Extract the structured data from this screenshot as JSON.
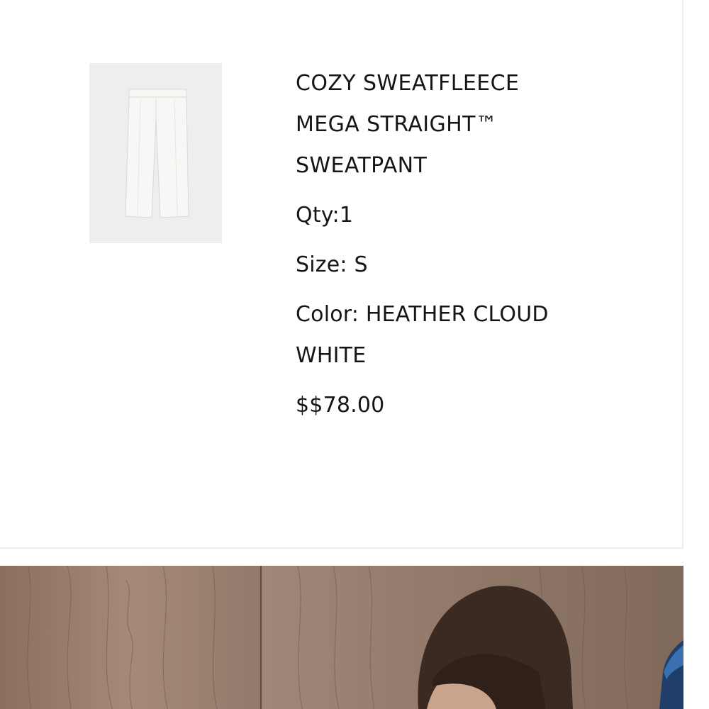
{
  "product": {
    "title": "COZY SWEATFLEECE MEGA STRAIGHT™ SWEATPANT",
    "qty_label": "Qty:",
    "qty_value": "1",
    "size_label": "Size:",
    "size_value": "S",
    "color_label": "Color:",
    "color_value": "HEATHER CLOUD WHITE",
    "price": "$$78.00",
    "thumbnail_icon": "sweatpant-image"
  },
  "banner": {
    "image_icon": "model-photo"
  },
  "colors": {
    "thumb_bg": "#eeeeee",
    "text": "#151515",
    "wood": "#9a8272",
    "hair": "#3b2a22"
  }
}
